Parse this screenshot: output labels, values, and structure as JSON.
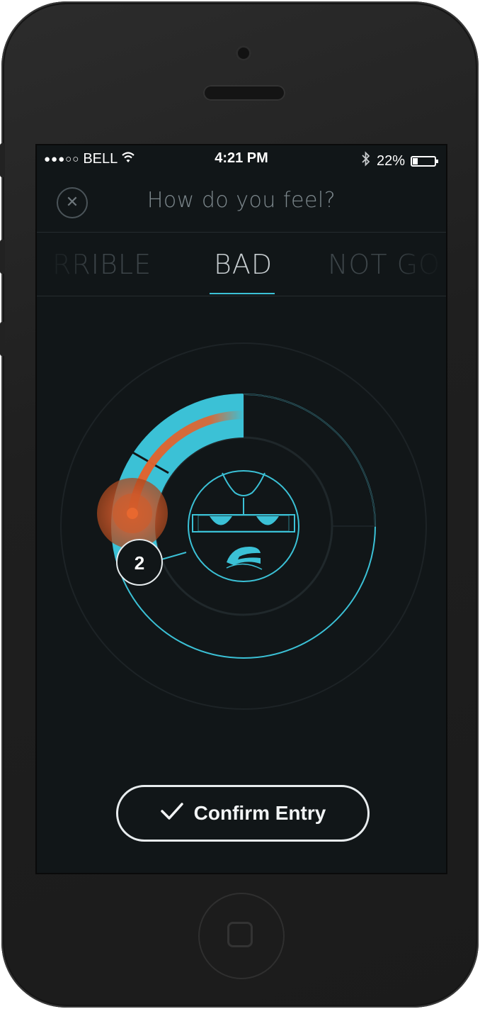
{
  "status_bar": {
    "signal": "●●●○○",
    "carrier": "BELL",
    "time": "4:21 PM",
    "battery_text": "22%",
    "battery_level": 0.22
  },
  "header": {
    "title": "How do you feel?",
    "close_icon": "close-icon"
  },
  "mood_tabs": {
    "items": [
      "RRIBLE",
      "BAD",
      "NOT GO"
    ],
    "selected": "BAD"
  },
  "dial": {
    "value": "2",
    "level_fraction": 0.25,
    "colors": {
      "accent": "#3bc1d6",
      "handle": "#e0642f",
      "background": "#111618"
    },
    "face_icon": "sad-face-icon"
  },
  "confirm": {
    "label": "Confirm Entry",
    "icon": "checkmark-icon"
  }
}
